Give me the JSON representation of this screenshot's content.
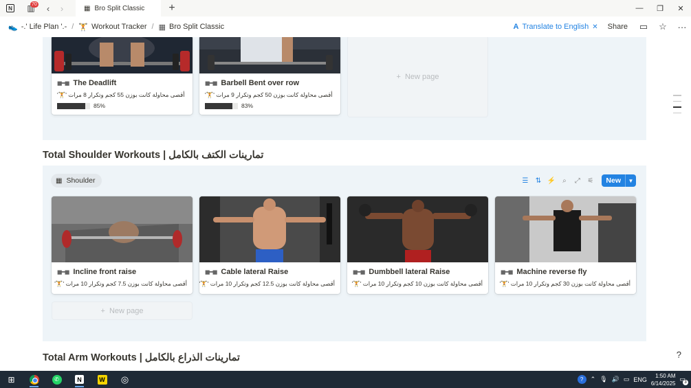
{
  "titlebar": {
    "inbox_badge": "70",
    "tab_title": "Bro Split Classic"
  },
  "breadcrumb": {
    "items": [
      {
        "label": "-.' Life Plan '.-"
      },
      {
        "label": "Workout Tracker"
      },
      {
        "label": "Bro Split Classic"
      }
    ]
  },
  "topbar": {
    "translate_label": "Translate to English",
    "share_label": "Share"
  },
  "back_gallery": {
    "cards": [
      {
        "title": "The Deadlift",
        "prop": "أقصى محاولة كانت بوزن 55 كجم وتكرار 8 مرات '🏋'",
        "progress_label": "85%",
        "progress": 0.85
      },
      {
        "title": "Barbell Bent over row",
        "prop": "أقصى محاولة كانت بوزن 50 كجم وتكرار 9 مرات '🏋'",
        "progress_label": "83%",
        "progress": 0.83
      }
    ],
    "new_page_label": "New page"
  },
  "shoulder_section": {
    "heading": "Total Shoulder Workouts | تمارينات الكتف بالكامل",
    "view_tab_label": "Shoulder",
    "new_button_label": "New",
    "cards": [
      {
        "title": "Incline front raise",
        "prop": "أقصى محاولة كانت بوزن 7.5 كجم وتكرار 10 مرات '🏋'"
      },
      {
        "title": "Cable lateral Raise",
        "prop": "أقصى محاولة كانت بوزن 12.5 كجم وتكرار 10 مرات '🏋'"
      },
      {
        "title": "Dumbbell lateral Raise",
        "prop": "أقصى محاولة كانت بوزن 10 كجم وتكرار 10 مرات '🏋'"
      },
      {
        "title": "Machine reverse fly",
        "prop": "أقصى محاولة كانت بوزن 30 كجم وتكرار 10 مرات '🏋'"
      }
    ],
    "new_page_label": "New page"
  },
  "arm_section": {
    "heading": "Total Arm Workouts | تمارينات الذراع بالكامل"
  },
  "taskbar": {
    "tray_lang": "ENG",
    "time": "1:50 AM",
    "date": "6/14/2025",
    "notif_count": "3"
  },
  "colors": {
    "accent": "#2383e2",
    "gallery_bg": "#eef4f8",
    "taskbar": "#1f2a36"
  },
  "icons": {
    "notion": "notion-logo-icon",
    "inbox": "inbox-icon",
    "dumbbell": "dumbbell-icon",
    "gallery": "gallery-view-icon",
    "filter": "filter-icon",
    "sort": "sort-icon",
    "automation": "lightning-icon",
    "search": "search-icon",
    "expand": "expand-icon",
    "settings": "sliders-icon"
  }
}
